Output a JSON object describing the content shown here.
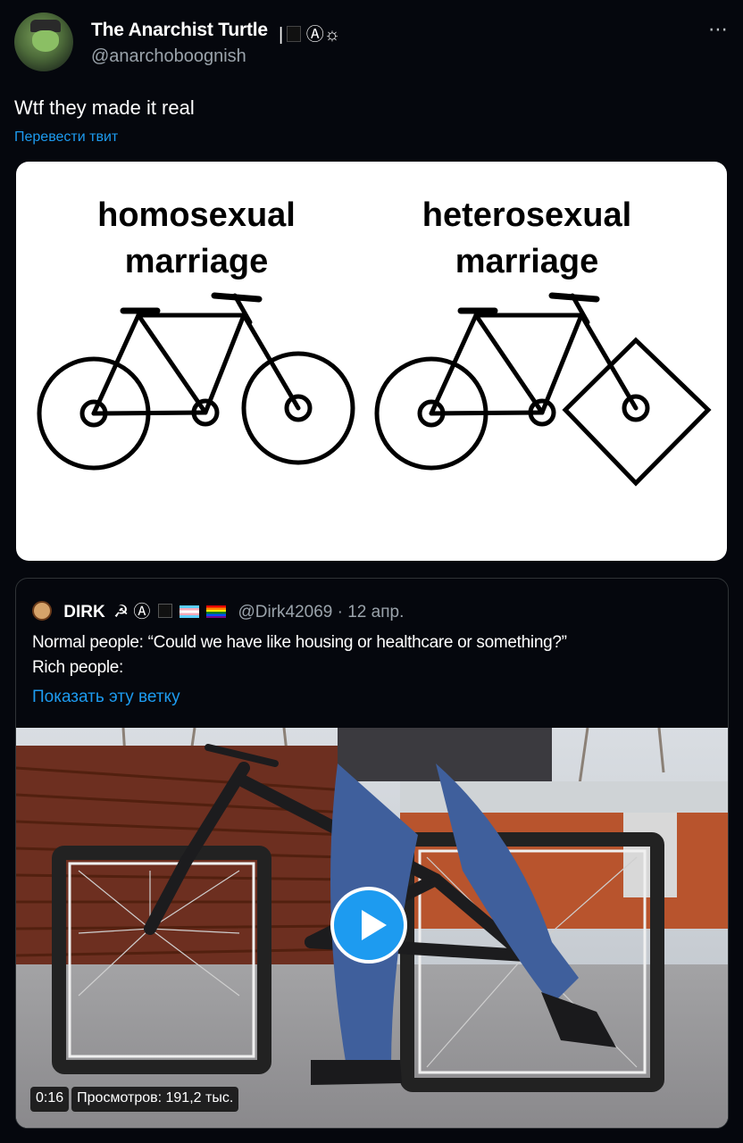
{
  "author": {
    "display_name": "The Anarchist Turtle",
    "name_suffix": "Ⓐ☼",
    "handle": "@anarchoboognish",
    "more_icon": "⋯"
  },
  "tweet": {
    "text": "Wtf they made it real",
    "translate_label": "Перевести твит"
  },
  "meme": {
    "left_title_line1": "homosexual",
    "left_title_line2": "marriage",
    "right_title_line1": "heterosexual",
    "right_title_line2": "marriage"
  },
  "quote": {
    "name": "DIRK",
    "badges": "☭ Ⓐ",
    "handle_date": "@Dirk42069 · 12 апр.",
    "text_line1": "Normal people: “Could we have like housing or healthcare or something?”",
    "text_line2": "Rich people:",
    "thread_label": "Показать эту ветку",
    "video_time": "0:16",
    "video_views": "Просмотров: 191,2 тыс."
  },
  "colors": {
    "background": "#05070d",
    "accent": "#1d9bf0",
    "secondary_text": "#9aa3ab"
  }
}
